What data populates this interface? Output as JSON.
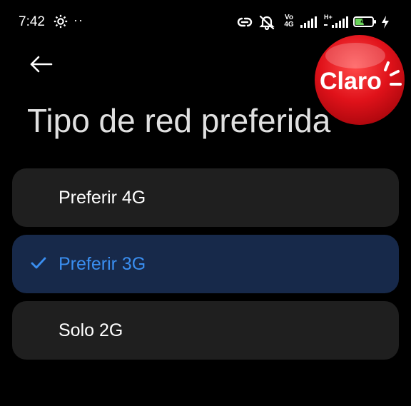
{
  "status_bar": {
    "time": "7:42",
    "dots": "··",
    "network_label": "Vo\n4G",
    "data_type": "H+",
    "battery_level": "45"
  },
  "header": {
    "title": "Tipo de red preferida",
    "back_icon": "arrow-left-icon"
  },
  "overlay": {
    "logo_text": "Claro"
  },
  "options": [
    {
      "label": "Preferir 4G",
      "selected": false
    },
    {
      "label": "Preferir 3G",
      "selected": true
    },
    {
      "label": "Solo 2G",
      "selected": false
    }
  ],
  "colors": {
    "background": "#000000",
    "option_bg": "#1f1f1f",
    "selected_bg": "#17294a",
    "accent": "#3a8ef0",
    "battery_fill": "#6ad35a",
    "logo_red": "#e0121a"
  }
}
